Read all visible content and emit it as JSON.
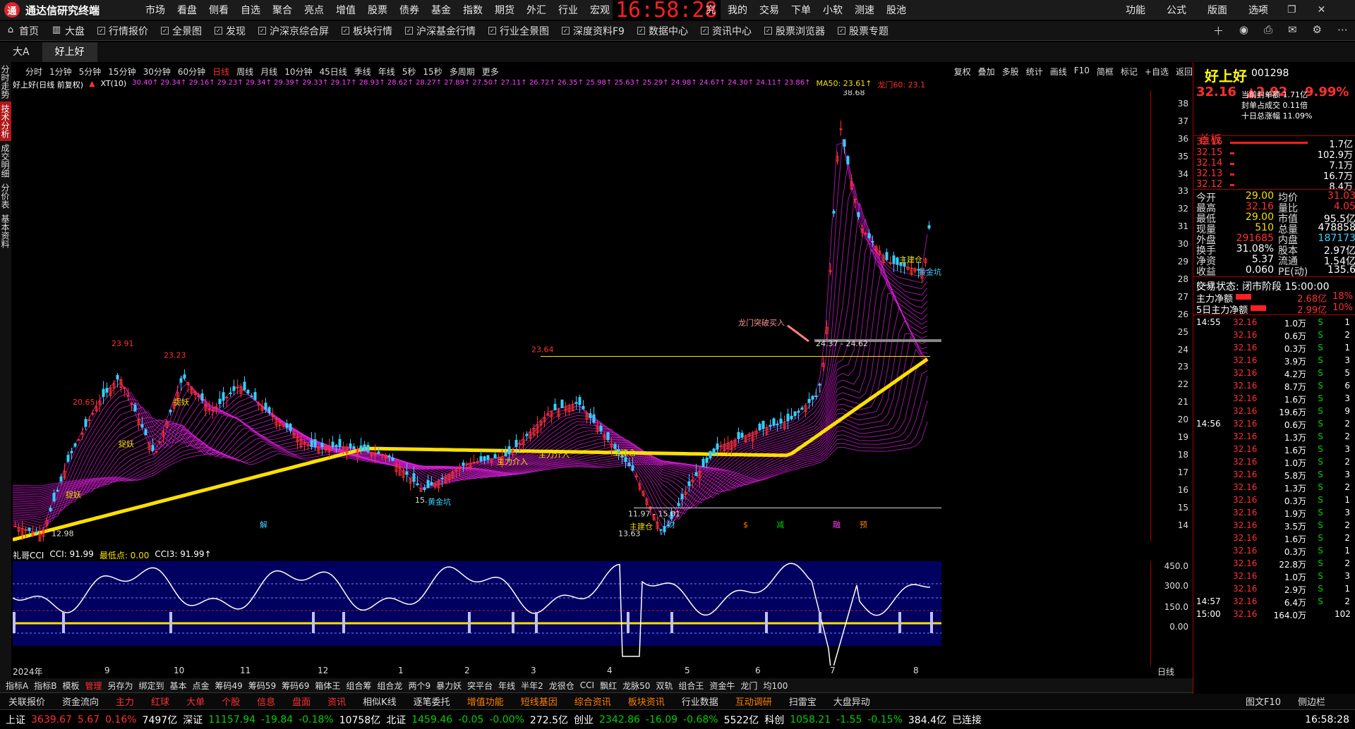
{
  "app": {
    "name": "通达信研究终端",
    "logo": "通",
    "clock": "16:58:28",
    "menu": [
      "市场",
      "看盘",
      "侧看",
      "自选",
      "聚合",
      "亮点",
      "增值",
      "股票",
      "债券",
      "基金",
      "指数",
      "期货",
      "外汇",
      "行业",
      "宏观"
    ],
    "menu_after": [
      "究",
      "我的",
      "交易",
      "下单",
      "小软",
      "测速",
      "股池"
    ],
    "right_menu": [
      "功能",
      "公式",
      "版面",
      "选项"
    ]
  },
  "nav": [
    "首页",
    "大盘",
    "行情报价",
    "全景图",
    "发现",
    "沪深京综合屏",
    "板块行情",
    "沪深基金行情",
    "行业全景图",
    "深度资料F9",
    "数据中心",
    "资讯中心",
    "股票浏览器",
    "股票专题"
  ],
  "tabs": [
    "大A",
    "好上好"
  ],
  "leftbar": [
    "分时走势",
    "技术分析",
    "成交明细",
    "分价表",
    "基本资料"
  ],
  "periods": [
    "分时",
    "1分钟",
    "5分钟",
    "15分钟",
    "30分钟",
    "60分钟",
    "日线",
    "周线",
    "月线",
    "10分钟",
    "45日线",
    "季线",
    "年线",
    "5秒",
    "15秒",
    "多周期",
    "更多"
  ],
  "tools": [
    "复权",
    "叠加",
    "多股",
    "统计",
    "画线",
    "F10",
    "简框",
    "标记",
    "+自选",
    "返回"
  ],
  "chartinfo": {
    "title": "好上好(日线 前复权)",
    "indicator": "XT(10)",
    "xt": "30.40↑ 29.34↑ 29.16↑ 29.23↑ 29.34↑ 29.39↑ 29.33↑ 29.17↑ 28.93↑ 28.62↑ 28.27↑ 27.89↑ 27.50↑ 27.11↑ 26.72↑ 26.35↑ 25.98↑ 25.63↑ 25.29↑ 24.98↑ 24.67↑ 24.30↑ 24.11↑ 23.86↑",
    "ma50": "MA50: 23.61↑",
    "lm": "龙门60: 23.1"
  },
  "chart_data": {
    "type": "candlestick",
    "y_ticks": [
      38,
      37,
      36,
      35,
      34,
      33,
      32,
      31,
      30,
      29,
      28,
      27,
      26,
      25,
      24,
      23,
      22,
      21,
      20,
      19,
      18,
      17,
      16,
      15,
      14
    ],
    "annotations": [
      "23.91",
      "23.23",
      "20.65",
      "23.64",
      "38.68",
      "12.98",
      "11.97 - 15.01",
      "24.37 - 24.62",
      "龙门突破买入",
      "主力介入",
      "主力介入",
      "主建仓",
      "主建仓",
      "黄金坑",
      "黄金坑",
      "捉妖",
      "捉妖",
      "捉妖",
      "13.63",
      "15.",
      "主建仓",
      "解",
      "财",
      "$",
      "减",
      "融",
      "预"
    ],
    "x_labels": [
      "2024年",
      "9",
      "10",
      "11",
      "12",
      "1",
      "2",
      "3",
      "4",
      "5",
      "6",
      "7",
      "8"
    ]
  },
  "cci": {
    "name": "礼哥CCI",
    "cci": "CCI: 91.99",
    "low": "最低点: 0.00",
    "cci3": "CCI3: 91.99↑",
    "ticks": [
      "450.0",
      "300.0",
      "150.0",
      "0.00"
    ]
  },
  "rightpanel": {
    "name": "好上好",
    "code": "001298",
    "price": "32.16",
    "chg": "▲2.92",
    "pct": "9.99%",
    "badge": "首板",
    "info": [
      "当前封单额  1.71亿",
      "封单占成交  0.11倍",
      "十日总涨幅  11.09%"
    ],
    "bids": [
      [
        "32.16",
        "1.7亿"
      ],
      [
        "32.15",
        "102.9万"
      ],
      [
        "32.14",
        "7.1万"
      ],
      [
        "32.13",
        "16.7万"
      ],
      [
        "32.12",
        "8.4万"
      ]
    ],
    "stats": [
      [
        "今开",
        "29.00"
      ],
      [
        "均价",
        "31.03"
      ],
      [
        "最高",
        "32.16"
      ],
      [
        "量比",
        "4.05"
      ],
      [
        "最低",
        "29.00"
      ],
      [
        "市值",
        "95.5亿"
      ],
      [
        "现量",
        "510"
      ],
      [
        "总量",
        "478858"
      ],
      [
        "外盘",
        "291685"
      ],
      [
        "内盘",
        "187173"
      ],
      [
        "换手",
        "31.08%"
      ],
      [
        "股本",
        "2.97亿"
      ],
      [
        "净资",
        "5.37"
      ],
      [
        "流通",
        "1.54亿"
      ],
      [
        "收益(一)",
        "0.060"
      ],
      [
        "PE(动)",
        "135.6"
      ]
    ],
    "state": "交易状态: 闭市阶段 15:00:00",
    "flow": [
      [
        "主力净额",
        "2.68亿",
        "18%"
      ],
      [
        "5日主力净额",
        "2.99亿",
        "10%"
      ]
    ],
    "ticks": [
      [
        "14:55",
        "32.16",
        "1.0万",
        "S",
        "1"
      ],
      [
        "",
        "32.16",
        "0.6万",
        "S",
        "2"
      ],
      [
        "",
        "32.16",
        "0.3万",
        "S",
        "1"
      ],
      [
        "",
        "32.16",
        "3.9万",
        "S",
        "3"
      ],
      [
        "",
        "32.16",
        "4.2万",
        "S",
        "5"
      ],
      [
        "",
        "32.16",
        "8.7万",
        "S",
        "6"
      ],
      [
        "",
        "32.16",
        "1.6万",
        "S",
        "3"
      ],
      [
        "",
        "32.16",
        "19.6万",
        "S",
        "9"
      ],
      [
        "14:56",
        "32.16",
        "0.6万",
        "S",
        "2"
      ],
      [
        "",
        "32.16",
        "1.3万",
        "S",
        "2"
      ],
      [
        "",
        "32.16",
        "1.6万",
        "S",
        "3"
      ],
      [
        "",
        "32.16",
        "1.0万",
        "S",
        "2"
      ],
      [
        "",
        "32.16",
        "5.8万",
        "S",
        "3"
      ],
      [
        "",
        "32.16",
        "1.3万",
        "S",
        "2"
      ],
      [
        "",
        "32.16",
        "0.3万",
        "S",
        "1"
      ],
      [
        "",
        "32.16",
        "1.9万",
        "S",
        "3"
      ],
      [
        "",
        "32.16",
        "3.5万",
        "S",
        "2"
      ],
      [
        "",
        "32.16",
        "1.6万",
        "S",
        "2"
      ],
      [
        "",
        "32.16",
        "0.3万",
        "S",
        "1"
      ],
      [
        "",
        "32.16",
        "22.8万",
        "S",
        "2"
      ],
      [
        "",
        "32.16",
        "1.0万",
        "S",
        "3"
      ],
      [
        "",
        "32.16",
        "2.9万",
        "S",
        "1"
      ],
      [
        "14:57",
        "32.16",
        "6.4万",
        "S",
        "2"
      ],
      [
        "15:00",
        "32.16",
        "164.0万",
        "",
        "102"
      ]
    ]
  },
  "bottomtabs": [
    "指标A",
    "指标B",
    "模板",
    "管理",
    "另存为",
    "绑定到",
    "基本",
    "点金",
    "筹码49",
    "筹码59",
    "筹码69",
    "箱体王",
    "组合筹",
    "组合龙",
    "两个9",
    "暴力妖",
    "突平台",
    "年线",
    "半年2",
    "龙很仓",
    "CCI",
    "飘红",
    "龙脉50",
    "双轨",
    "组合王",
    "资金牛",
    "龙门",
    "均100"
  ],
  "bottomtabs2": [
    "关联报价",
    "资金流向",
    "主力",
    "红球",
    "大单",
    "个股",
    "信息",
    "盘面",
    "资讯",
    "相似K线",
    "逐笔委托",
    "增值功能",
    "短线基因",
    "综合资讯",
    "板块资讯",
    "行业数据",
    "互动调研",
    "扫雷宝",
    "大盘异动"
  ],
  "status": {
    "sh": [
      "上证",
      "3639.67",
      "5.67",
      "0.16%",
      "7497亿"
    ],
    "sz": [
      "深证",
      "11157.94",
      "-19.84",
      "-0.18%",
      "10758亿"
    ],
    "bz": [
      "北证",
      "1459.46",
      "-0.05",
      "-0.00%",
      "272.5亿"
    ],
    "cy": [
      "创业",
      "2342.86",
      "-16.09",
      "-0.68%",
      "5522亿"
    ],
    "kc": [
      "科创",
      "1058.21",
      "-1.55",
      "-0.15%",
      "384.4亿"
    ],
    "conn": "已连接",
    "time": "16:58:28",
    "right_btns": [
      "图文F10",
      "侧边栏"
    ]
  }
}
